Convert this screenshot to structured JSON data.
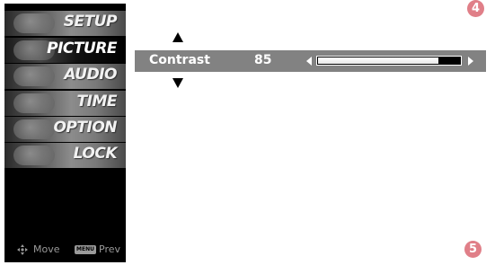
{
  "menu": {
    "items": [
      {
        "label": "SETUP",
        "selected": false
      },
      {
        "label": "PICTURE",
        "selected": true
      },
      {
        "label": "AUDIO",
        "selected": false
      },
      {
        "label": "TIME",
        "selected": false
      },
      {
        "label": "OPTION",
        "selected": false
      },
      {
        "label": "LOCK",
        "selected": false
      }
    ],
    "footer": {
      "move_icon": "move-cross-icon",
      "move_label": "Move",
      "menu_key_label": "MENU",
      "prev_label": "Prev"
    }
  },
  "adjustment": {
    "label": "Contrast",
    "value": "85",
    "level_percent": 85,
    "up_icon": "up-arrow-icon",
    "down_icon": "down-arrow-icon",
    "left_icon": "left-triangle-icon",
    "right_icon": "right-triangle-icon"
  },
  "annotations": {
    "step_top": "4",
    "step_bottom": "5",
    "badge_color": "#e07f88"
  },
  "colors": {
    "sidebar_bg": "#000000",
    "adjust_bar_bg": "#828282",
    "slider_fill": "#ffffff"
  }
}
